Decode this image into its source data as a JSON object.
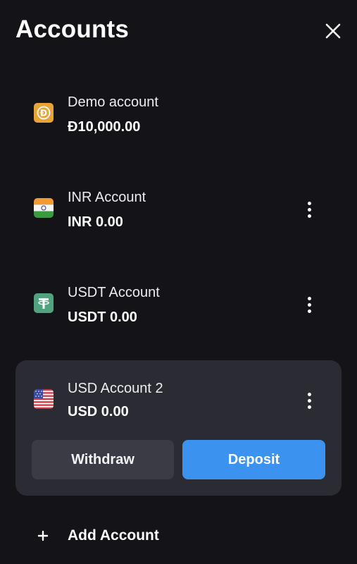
{
  "header": {
    "title": "Accounts",
    "close_icon": "close-icon"
  },
  "accounts": [
    {
      "name": "Demo account",
      "balance": "Đ10,000.00",
      "icon": "demo-coin-icon",
      "icon_glyph": "Đ",
      "icon_color": "#e8a436",
      "has_menu": false
    },
    {
      "name": "INR Account",
      "balance": "INR 0.00",
      "icon": "india-flag-icon",
      "has_menu": true
    },
    {
      "name": "USDT Account",
      "balance": "USDT 0.00",
      "icon": "tether-icon",
      "icon_color": "#50a37e",
      "has_menu": true
    },
    {
      "name": "USD Account 2",
      "balance": "USD 0.00",
      "icon": "usa-flag-icon",
      "has_menu": true,
      "selected": true
    }
  ],
  "actions": {
    "withdraw_label": "Withdraw",
    "deposit_label": "Deposit"
  },
  "footer": {
    "add_account_label": "Add Account",
    "add_icon": "plus-icon"
  },
  "colors": {
    "background": "#131318",
    "card": "#2a2b33",
    "withdraw_button": "#3a3b44",
    "deposit_button": "#3c92ef"
  }
}
